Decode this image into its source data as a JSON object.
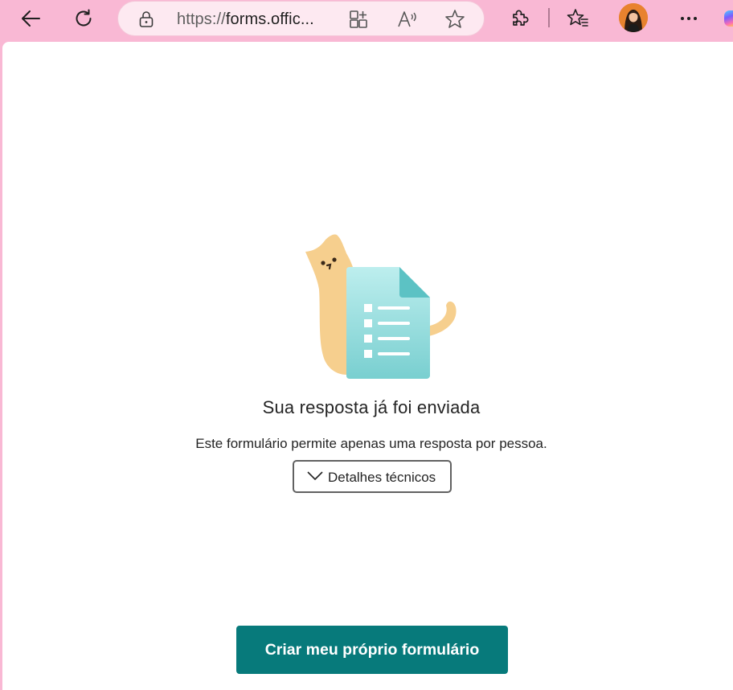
{
  "browser": {
    "url_prefix": "https://",
    "url_domain": "forms.offic...",
    "icons": {
      "back": "back-arrow-icon",
      "refresh": "refresh-icon",
      "lock": "lock-icon",
      "app_available": "app-available-icon",
      "read_aloud": "read-aloud-icon",
      "favorite": "star-icon",
      "extensions": "puzzle-icon",
      "favorites": "favorites-list-icon",
      "more": "more-icon"
    },
    "chrome_color": "#f9b8d4"
  },
  "message": {
    "title": "Sua resposta já foi enviada",
    "subtitle": "Este formulário permite apenas uma resposta por pessoa.",
    "details_label": "Detalhes técnicos"
  },
  "actions": {
    "create_label": "Criar meu próprio formulário",
    "create_color": "#077a7b"
  }
}
